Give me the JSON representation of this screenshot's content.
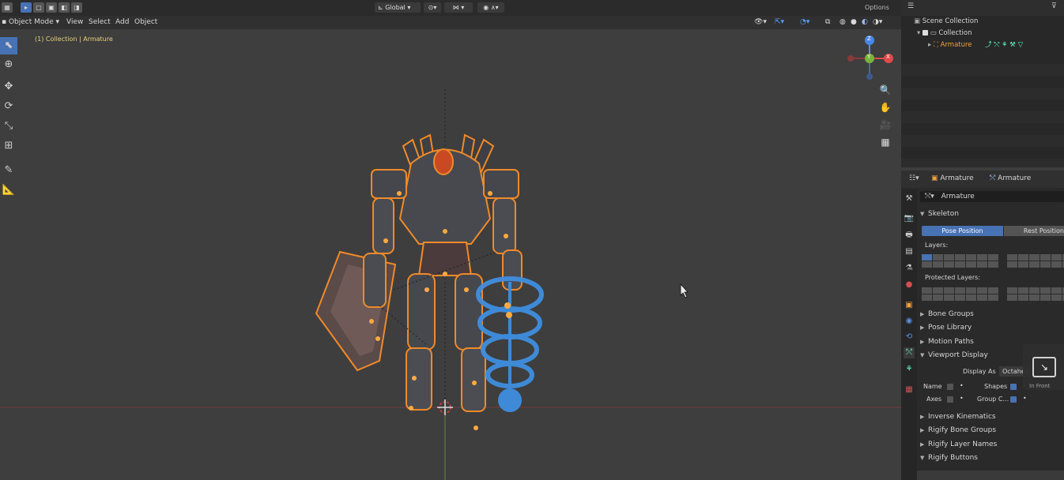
{
  "toolbar": {
    "transform_orientation": "Global",
    "options_label": "Options"
  },
  "menubar": {
    "mode": "Object Mode",
    "items": [
      "View",
      "Select",
      "Add",
      "Object"
    ]
  },
  "viewport": {
    "overlay_text": "(1) Collection | Armature",
    "gizmo": {
      "z": "Z",
      "y": "Y",
      "x": "X"
    }
  },
  "outliner": {
    "scene_collection": "Scene Collection",
    "collection": "Collection",
    "armature": "Armature"
  },
  "properties": {
    "header_object": "Armature",
    "header_data": "Armature",
    "data_name": "Armature",
    "skeleton_label": "Skeleton",
    "pose_position": "Pose Position",
    "rest_position": "Rest Position",
    "layers_label": "Layers:",
    "protected_layers_label": "Protected Layers:",
    "panels": [
      "Bone Groups",
      "Pose Library",
      "Motion Paths"
    ],
    "viewport_display": "Viewport Display",
    "display_as_label": "Display As",
    "display_as_value": "Octahed",
    "name_label": "Name",
    "axes_label": "Axes",
    "shapes_label": "Shapes",
    "group_label": "Group C...",
    "in_front_label": "In Front",
    "lower_panels": [
      "Inverse Kinematics",
      "Rigify Bone Groups",
      "Rigify Layer Names",
      "Rigify Buttons"
    ]
  },
  "colors": {
    "accent": "#4772b3",
    "selection_orange": "#f08a2a",
    "active_orange": "#ffaa40",
    "shape_blue": "#3f8fe0"
  }
}
